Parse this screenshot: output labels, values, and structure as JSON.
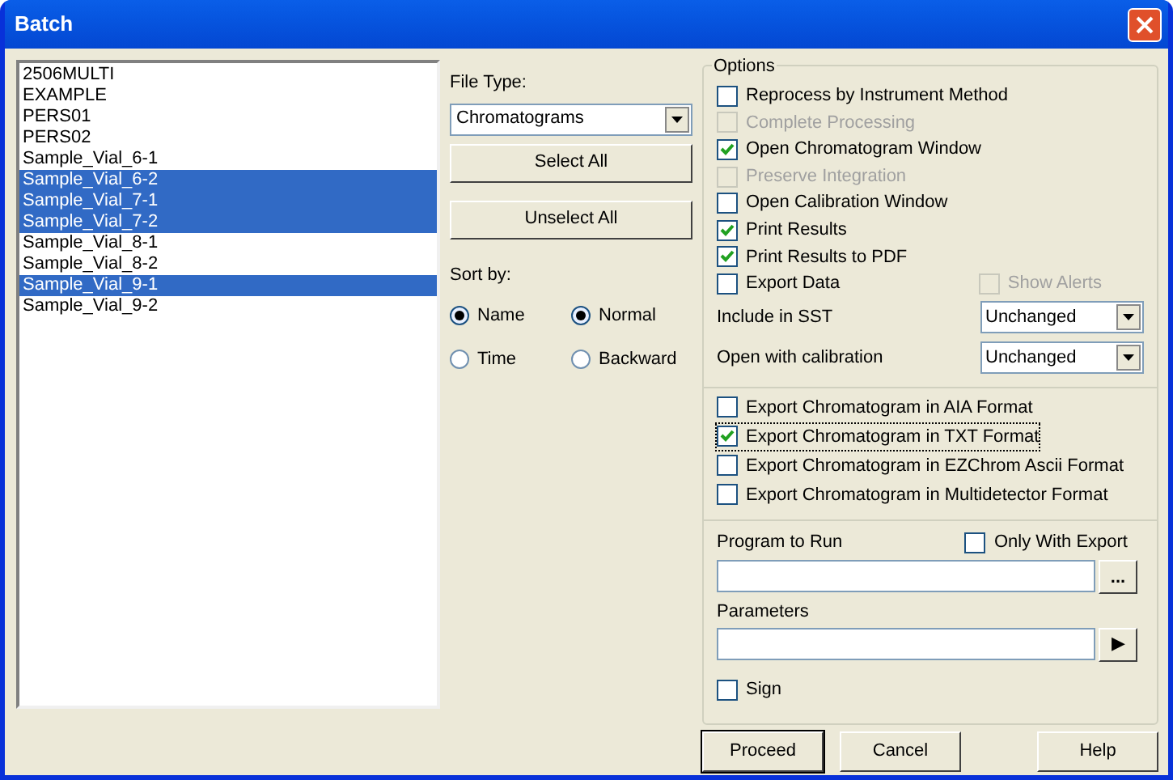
{
  "window": {
    "title": "Batch"
  },
  "file_list": [
    {
      "label": "2506MULTI",
      "selected": false
    },
    {
      "label": "EXAMPLE",
      "selected": false
    },
    {
      "label": "PERS01",
      "selected": false
    },
    {
      "label": "PERS02",
      "selected": false
    },
    {
      "label": "Sample_Vial_6-1",
      "selected": false
    },
    {
      "label": "Sample_Vial_6-2",
      "selected": true
    },
    {
      "label": "Sample_Vial_7-1",
      "selected": true
    },
    {
      "label": "Sample_Vial_7-2",
      "selected": true
    },
    {
      "label": "Sample_Vial_8-1",
      "selected": false
    },
    {
      "label": "Sample_Vial_8-2",
      "selected": false
    },
    {
      "label": "Sample_Vial_9-1",
      "selected": true
    },
    {
      "label": "Sample_Vial_9-2",
      "selected": false
    }
  ],
  "file_type": {
    "label": "File Type:",
    "value": "Chromatograms"
  },
  "list_buttons": [
    "Select All",
    "Unselect All"
  ],
  "sort_by": {
    "label": "Sort by:",
    "field": [
      {
        "label": "Name",
        "selected": true
      },
      {
        "label": "Time",
        "selected": false
      }
    ],
    "order": [
      {
        "label": "Normal",
        "selected": true
      },
      {
        "label": "Backward",
        "selected": false
      }
    ]
  },
  "options": {
    "title": "Options",
    "checkboxes": [
      {
        "label": "Reprocess by Instrument Method",
        "checked": false,
        "disabled": false
      },
      {
        "label": "Complete Processing",
        "checked": false,
        "disabled": true
      },
      {
        "label": "Open Chromatogram Window",
        "checked": true,
        "disabled": false
      },
      {
        "label": "Preserve Integration",
        "checked": false,
        "disabled": true
      },
      {
        "label": "Open Calibration Window",
        "checked": false,
        "disabled": false
      },
      {
        "label": "Print Results",
        "checked": true,
        "disabled": false
      },
      {
        "label": "Print Results to PDF",
        "checked": true,
        "disabled": false
      },
      {
        "label": "Export Data",
        "checked": false,
        "disabled": false
      }
    ],
    "show_alerts": {
      "label": "Show Alerts",
      "checked": false,
      "disabled": true
    },
    "dropdowns": [
      {
        "label": "Include in SST",
        "value": "Unchanged"
      },
      {
        "label": "Open with calibration",
        "value": "Unchanged"
      }
    ],
    "export_formats": [
      {
        "label": "Export Chromatogram in AIA Format",
        "checked": false,
        "focused": false
      },
      {
        "label": "Export Chromatogram in TXT Format",
        "checked": true,
        "focused": true
      },
      {
        "label": "Export Chromatogram in EZChrom Ascii Format",
        "checked": false,
        "focused": false
      },
      {
        "label": "Export Chromatogram in Multidetector Format",
        "checked": false,
        "focused": false
      }
    ],
    "program_to_run": {
      "label": "Program to Run",
      "browse": "...",
      "only_with_export": {
        "label": "Only With Export",
        "checked": false
      }
    },
    "parameters": {
      "label": "Parameters",
      "arrow": "▶"
    },
    "sign": {
      "label": "Sign",
      "checked": false
    }
  },
  "footer_buttons": [
    "Proceed",
    "Cancel",
    "Help"
  ]
}
